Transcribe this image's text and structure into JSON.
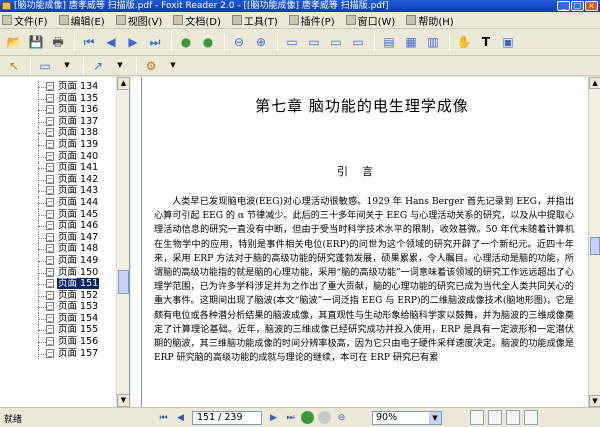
{
  "window": {
    "title": "[脑功能成像] 唐孝威等 扫描版.pdf - Foxit Reader 2.0 - [[脑功能成像] 唐孝威等 扫描版.pdf]",
    "buttons": [
      "_",
      "□",
      "×"
    ]
  },
  "menu": {
    "items": [
      "文件(F)",
      "编辑(E)",
      "视图(V)",
      "文档(D)",
      "工具(T)",
      "插件(P)",
      "窗口(W)",
      "帮助(H)"
    ]
  },
  "toolbar1": {
    "icons": [
      "open-icon",
      "save-icon",
      "print-icon",
      "first-page-icon",
      "prev-page-icon",
      "next-page-icon",
      "last-page-icon",
      "go-back-icon",
      "go-forward-icon",
      "zoom-out-icon",
      "zoom-in-icon",
      "actual-size-icon",
      "fit-page-icon",
      "fit-width-icon",
      "fit-visible-icon",
      "single-page-icon",
      "continuous-icon",
      "facing-icon",
      "hand-tool-icon",
      "text-select-icon",
      "snapshot-icon"
    ],
    "glyphs": [
      "📂",
      "💾",
      "🖶",
      "⏮",
      "◀",
      "▶",
      "⏭",
      "●",
      "●",
      "⊖",
      "⊕",
      "▭",
      "▭",
      "▭",
      "▭",
      "▤",
      "▦",
      "▥",
      "✋",
      "T",
      "▣"
    ]
  },
  "toolbar2": {
    "glyphs": [
      "↖",
      "▭",
      "↗",
      "⚙"
    ]
  },
  "sidebar": {
    "pages": [
      {
        "label": "页面 134",
        "selected": false
      },
      {
        "label": "页面 135",
        "selected": false
      },
      {
        "label": "页面 136",
        "selected": false
      },
      {
        "label": "页面 137",
        "selected": false
      },
      {
        "label": "页面 138",
        "selected": false
      },
      {
        "label": "页面 139",
        "selected": false
      },
      {
        "label": "页面 140",
        "selected": false
      },
      {
        "label": "页面 141",
        "selected": false
      },
      {
        "label": "页面 142",
        "selected": false
      },
      {
        "label": "页面 143",
        "selected": false
      },
      {
        "label": "页面 144",
        "selected": false
      },
      {
        "label": "页面 145",
        "selected": false
      },
      {
        "label": "页面 146",
        "selected": false
      },
      {
        "label": "页面 147",
        "selected": false
      },
      {
        "label": "页面 148",
        "selected": false
      },
      {
        "label": "页面 149",
        "selected": false
      },
      {
        "label": "页面 150",
        "selected": false
      },
      {
        "label": "页面 151",
        "selected": true
      },
      {
        "label": "页面 152",
        "selected": false
      },
      {
        "label": "页面 153",
        "selected": false
      },
      {
        "label": "页面 154",
        "selected": false
      },
      {
        "label": "页面 155",
        "selected": false
      },
      {
        "label": "页面 156",
        "selected": false
      },
      {
        "label": "页面 157",
        "selected": false
      }
    ]
  },
  "document": {
    "chapter_title": "第七章  脑功能的电生理学成像",
    "section_title": "引言",
    "paragraph": "人类早已发现脑电波(EEG)对心理活动很敏感。1929 年 Hans Berger 首先记录到 EEG，并指出心算可引起 EEG 的 α 节律减少。此后的三十多年间关于 EEG 与心理活动关系的研究，以及从中提取心理活动信息的研究一直没有中断，但由于受当时科学技术水平的限制，收效甚微。50 年代末随着计算机在生物学中的应用，特别是事件相关电位(ERP)的问世为这个领域的研究开辟了一个新纪元。近四十年来，采用 ERP 方法对于脑的高级功能的研究蓬勃发展，硕果累累，令人瞩目。心理活动是脑的功能，所谓脑的高级功能指的就是脑的心理功能，采用“脑的高级功能”一词意味着该领域的研究工作远远超出了心理学范围，已为许多学科涉足并为之作出了重大贡献，脑的心理功能的研究已成为当代全人类共同关心的重大事件。这期间出现了脑波(本文“脑波”一词泛指 EEG 与 ERP)的二维脑波成像技术(脑地形图)，它是颇有电位或各种潜分析结果的脑波成像，其直观性与生动形象给脑科学家以鼓舞，并为脑波的三维成像奠定了计算理论基础。近年，脑波的三维成像已经研究成功并投入使用，ERP 是具有一定波形和一定潜伏期的脑波，其三维脑功能成像的时间分辨率极高，因为它只由电子硬件采样速度决定。脑波的功能成像是 ERP 研究脑的高级功能的成就与理论的继续，本可在 ERP 研究已有累"
  },
  "status": {
    "text": "就绪",
    "page_field": "151 / 239",
    "zoom": "90%"
  }
}
